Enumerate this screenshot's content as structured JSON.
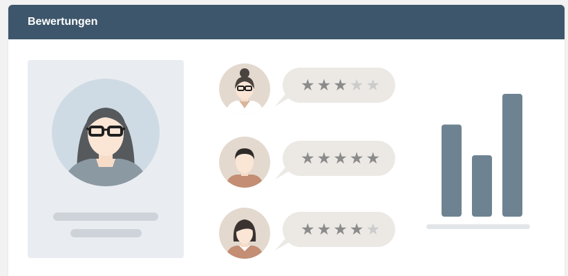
{
  "header": {
    "title": "Bewertungen"
  },
  "colors": {
    "header_bg": "#3d566b",
    "bar": "#6e8391",
    "star_filled": "#8b8b8b",
    "star_empty": "#cccccc"
  },
  "reviews": [
    {
      "avatar": "woman-with-glasses-avatar",
      "rating": 3,
      "max": 5
    },
    {
      "avatar": "man-avatar",
      "rating": 5,
      "max": 5
    },
    {
      "avatar": "woman-avatar",
      "rating": 4,
      "max": 5
    }
  ],
  "chart_data": {
    "type": "bar",
    "categories": [
      "",
      "",
      ""
    ],
    "values": [
      6,
      4,
      8
    ],
    "title": "",
    "xlabel": "",
    "ylabel": "",
    "ylim": [
      0,
      8
    ]
  }
}
